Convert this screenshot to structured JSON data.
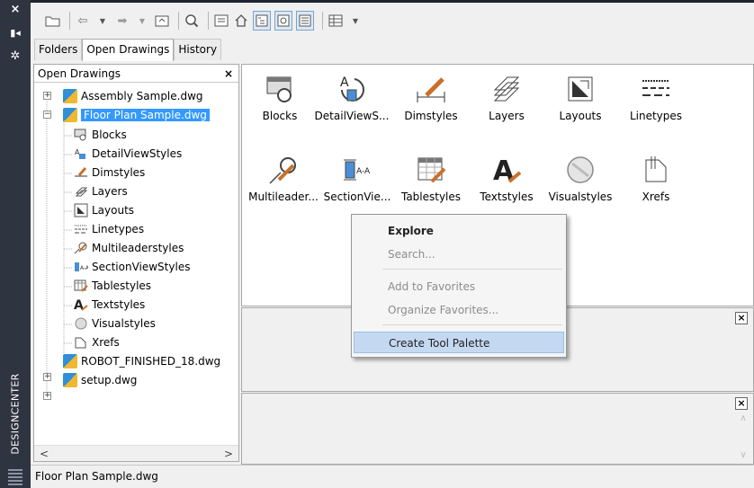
{
  "side": {
    "title": "DESIGNCENTER",
    "close": "×",
    "pin": "▮◂",
    "props": "✲"
  },
  "toolbar": {
    "open": "▱",
    "back": "⇦",
    "fwd": "➡",
    "up": "⊡",
    "search": "⌕",
    "fav": "⊞",
    "home": "⌂",
    "treeview": "⊟",
    "preview": "⊡",
    "desc": "▤",
    "views": "▦"
  },
  "tabs": [
    "Folders",
    "Open Drawings",
    "History"
  ],
  "tree": {
    "header": "Open Drawings",
    "close": "×",
    "items": [
      "Assembly Sample.dwg",
      "Floor Plan Sample.dwg",
      "Blocks",
      "DetailViewStyles",
      "Dimstyles",
      "Layers",
      "Layouts",
      "Linetypes",
      "Multileaderstyles",
      "SectionViewStyles",
      "Tablestyles",
      "Textstyles",
      "Visualstyles",
      "Xrefs",
      "ROBOT_FINISHED_18.dwg",
      "setup.dwg"
    ]
  },
  "content": {
    "items": [
      "Blocks",
      "DetailViewS...",
      "Dimstyles",
      "Layers",
      "Layouts",
      "Linetypes",
      "Multileader...",
      "SectionVie...",
      "Tablestyles",
      "Textstyles",
      "Visualstyles",
      "Xrefs"
    ]
  },
  "menu": {
    "items": [
      "Explore",
      "Search...",
      "Add to Favorites",
      "Organize Favorites...",
      "Create Tool Palette"
    ]
  },
  "status": "Floor Plan Sample.dwg"
}
